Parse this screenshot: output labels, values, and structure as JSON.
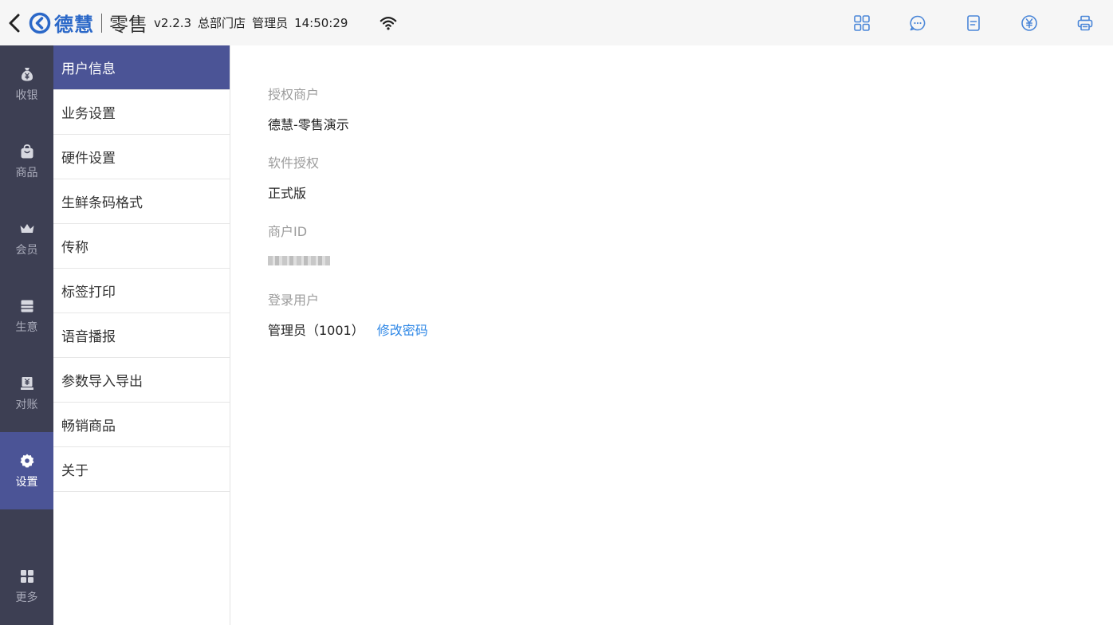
{
  "header": {
    "brand": "德慧",
    "product": "零售",
    "version": "v2.2.3",
    "store": "总部门店",
    "role": "管理员",
    "time": "14:50:29",
    "actions": [
      {
        "name": "grid-icon"
      },
      {
        "name": "chat-icon"
      },
      {
        "name": "document-icon"
      },
      {
        "name": "yuan-icon"
      },
      {
        "name": "printer-icon"
      }
    ]
  },
  "nav": {
    "items": [
      {
        "label": "收银",
        "icon": "moneybag-icon"
      },
      {
        "label": "商品",
        "icon": "bag-icon"
      },
      {
        "label": "会员",
        "icon": "crown-icon"
      },
      {
        "label": "生意",
        "icon": "ledger-icon"
      },
      {
        "label": "对账",
        "icon": "reconcile-icon"
      },
      {
        "label": "设置",
        "icon": "gear-icon",
        "active": true
      },
      {
        "label": "更多",
        "icon": "apps-icon"
      }
    ]
  },
  "menu": {
    "items": [
      {
        "label": "用户信息",
        "active": true
      },
      {
        "label": "业务设置"
      },
      {
        "label": "硬件设置"
      },
      {
        "label": "生鲜条码格式"
      },
      {
        "label": "传称"
      },
      {
        "label": "标签打印"
      },
      {
        "label": "语音播报"
      },
      {
        "label": "参数导入导出"
      },
      {
        "label": "畅销商品"
      },
      {
        "label": "关于"
      }
    ]
  },
  "user_info": {
    "merchant_label": "授权商户",
    "merchant_value": "德慧-零售演示",
    "license_label": "软件授权",
    "license_value": "正式版",
    "merchant_id_label": "商户ID",
    "login_label": "登录用户",
    "login_value": "管理员（1001）",
    "change_password": "修改密码"
  },
  "colors": {
    "accent": "#4b5496",
    "nav_bg": "#3d3f53",
    "link": "#2e87e6",
    "brand": "#2b68c8"
  }
}
